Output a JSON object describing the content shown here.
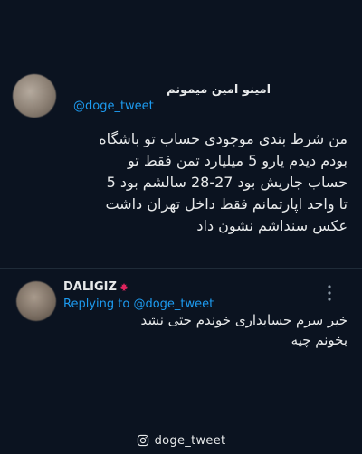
{
  "colors": {
    "background": "#0b1320",
    "text": "#e7e9ea",
    "link": "#1d9bf0",
    "divider": "#1f2b38"
  },
  "main_tweet": {
    "author_name": "امینو امین میمونم",
    "handle": "@doge_tweet",
    "body_lines": [
      "من شرط بندی موجودی حساب تو باشگاه",
      "بودم دیدم یارو 5 میلیارد تمن فقط تو",
      "حساب جاریش بود 27-28 سالشم بود 5",
      "تا واحد اپارتمانم فقط داخل تهران داشت",
      "عکس سنداشم نشون داد"
    ]
  },
  "reply_tweet": {
    "author_name": "DALIGIZ",
    "author_badge_icon": "maple-leaf-icon",
    "replying_prefix": "Replying to",
    "replying_handle": "@doge_tweet",
    "more_icon": "more-vertical-icon",
    "body_lines": [
      "خیر سرم حسابداری خوندم حتی نشد",
      "بخونم چیه"
    ]
  },
  "footer": {
    "icon": "instagram-icon",
    "text": "doge_tweet"
  }
}
